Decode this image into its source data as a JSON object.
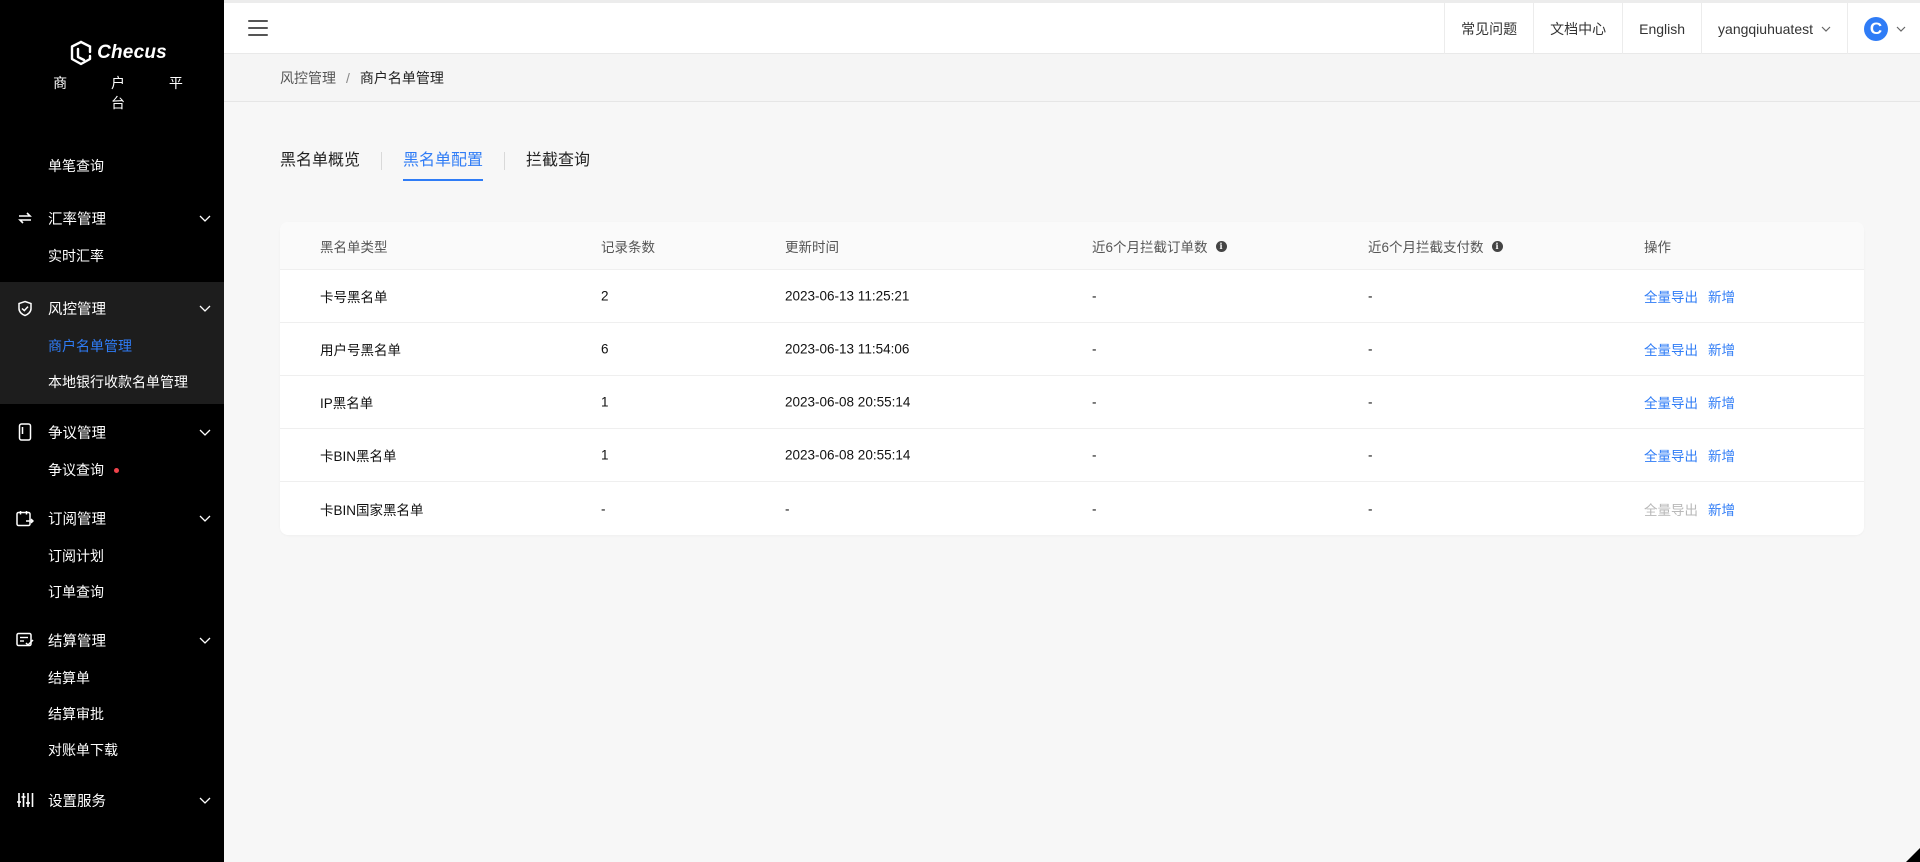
{
  "brand": {
    "name": "Checus",
    "subtitle": "商 户 平 台"
  },
  "sidebar": {
    "top_item": {
      "label": "单笔查询"
    },
    "groups": [
      {
        "label": "汇率管理",
        "icon": "exchange-icon",
        "items": [
          "实时汇率"
        ]
      },
      {
        "label": "风控管理",
        "icon": "shield-check-icon",
        "items": [
          "商户名单管理",
          "本地银行收款名单管理"
        ],
        "selected": "商户名单管理"
      },
      {
        "label": "争议管理",
        "icon": "phone-dispute-icon",
        "items": [
          "争议查询"
        ]
      },
      {
        "label": "订阅管理",
        "icon": "calendar-icon",
        "items": [
          "订阅计划",
          "订单查询"
        ]
      },
      {
        "label": "结算管理",
        "icon": "list-check-icon",
        "items": [
          "结算单",
          "结算审批",
          "对账单下载"
        ]
      },
      {
        "label": "设置服务",
        "icon": "sliders-icon",
        "items": []
      }
    ]
  },
  "topbar": {
    "faq": "常见问题",
    "docs": "文档中心",
    "language": "English",
    "username": "yangqiuhuatest",
    "avatar_letter": "C"
  },
  "breadcrumb": {
    "parent": "风控管理",
    "separator": "/",
    "current": "商户名单管理"
  },
  "tabs": [
    "黑名单概览",
    "黑名单配置",
    "拦截查询"
  ],
  "active_tab": "黑名单配置",
  "table": {
    "headers": [
      "黑名单类型",
      "记录条数",
      "更新时间",
      "近6个月拦截订单数",
      "近6个月拦截支付数",
      "操作"
    ],
    "rows": [
      {
        "type": "卡号黑名单",
        "count": "2",
        "updated": "2023-06-13 11:25:21",
        "orders": "-",
        "payments": "-",
        "export": "全量导出",
        "add": "新增",
        "export_disabled": false
      },
      {
        "type": "用户号黑名单",
        "count": "6",
        "updated": "2023-06-13 11:54:06",
        "orders": "-",
        "payments": "-",
        "export": "全量导出",
        "add": "新增",
        "export_disabled": false
      },
      {
        "type": "IP黑名单",
        "count": "1",
        "updated": "2023-06-08 20:55:14",
        "orders": "-",
        "payments": "-",
        "export": "全量导出",
        "add": "新增",
        "export_disabled": false
      },
      {
        "type": "卡BIN黑名单",
        "count": "1",
        "updated": "2023-06-08 20:55:14",
        "orders": "-",
        "payments": "-",
        "export": "全量导出",
        "add": "新增",
        "export_disabled": false
      },
      {
        "type": "卡BIN国家黑名单",
        "count": "-",
        "updated": "-",
        "orders": "-",
        "payments": "-",
        "export": "全量导出",
        "add": "新增",
        "export_disabled": true
      }
    ]
  },
  "colors": {
    "accent": "#2f7cf6",
    "sidebar_bg": "#000000",
    "alert_dot": "#f0434b"
  }
}
